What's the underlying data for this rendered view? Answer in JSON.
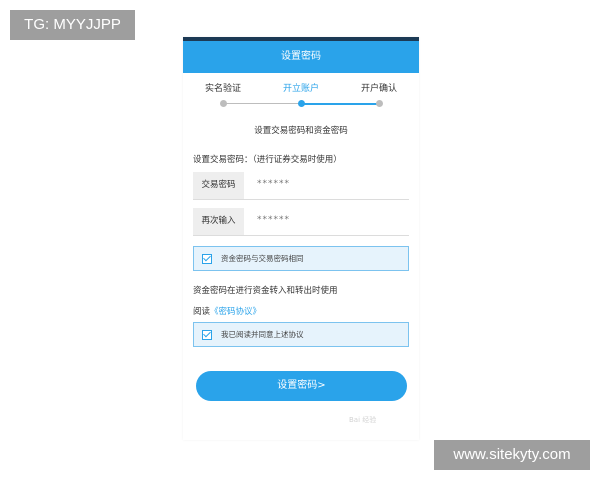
{
  "overlay": {
    "tag_label": "TG: MYYJJPP",
    "site_label": "www.sitekyty.com"
  },
  "header": {
    "title": "设置密码"
  },
  "steps": [
    {
      "label": "实名验证",
      "state": "done"
    },
    {
      "label": "开立账户",
      "state": "active"
    },
    {
      "label": "开户确认",
      "state": "pending"
    }
  ],
  "form": {
    "subtitle": "设置交易密码和资金密码",
    "section_label": "设置交易密码：（进行证券交易时使用）",
    "fields": [
      {
        "label": "交易密码",
        "value": "******"
      },
      {
        "label": "再次输入",
        "value": "******"
      }
    ],
    "same_password_checkbox": {
      "label": "资金密码与交易密码相同",
      "checked": true
    },
    "fund_note": "资金密码在进行资金转入和转出时使用",
    "agreement_prefix": "阅读",
    "agreement_link": "《密码协议》",
    "agree_checkbox": {
      "label": "我已阅读并同意上述协议",
      "checked": true
    },
    "submit_label": "设置密码>"
  },
  "watermark": {
    "text": "Bai 经验"
  },
  "colors": {
    "accent": "#2aa3ea",
    "status_bar": "#1c3a55",
    "overlay_bg": "#9e9e9e",
    "checkbox_row_bg": "#e6f3fc"
  }
}
